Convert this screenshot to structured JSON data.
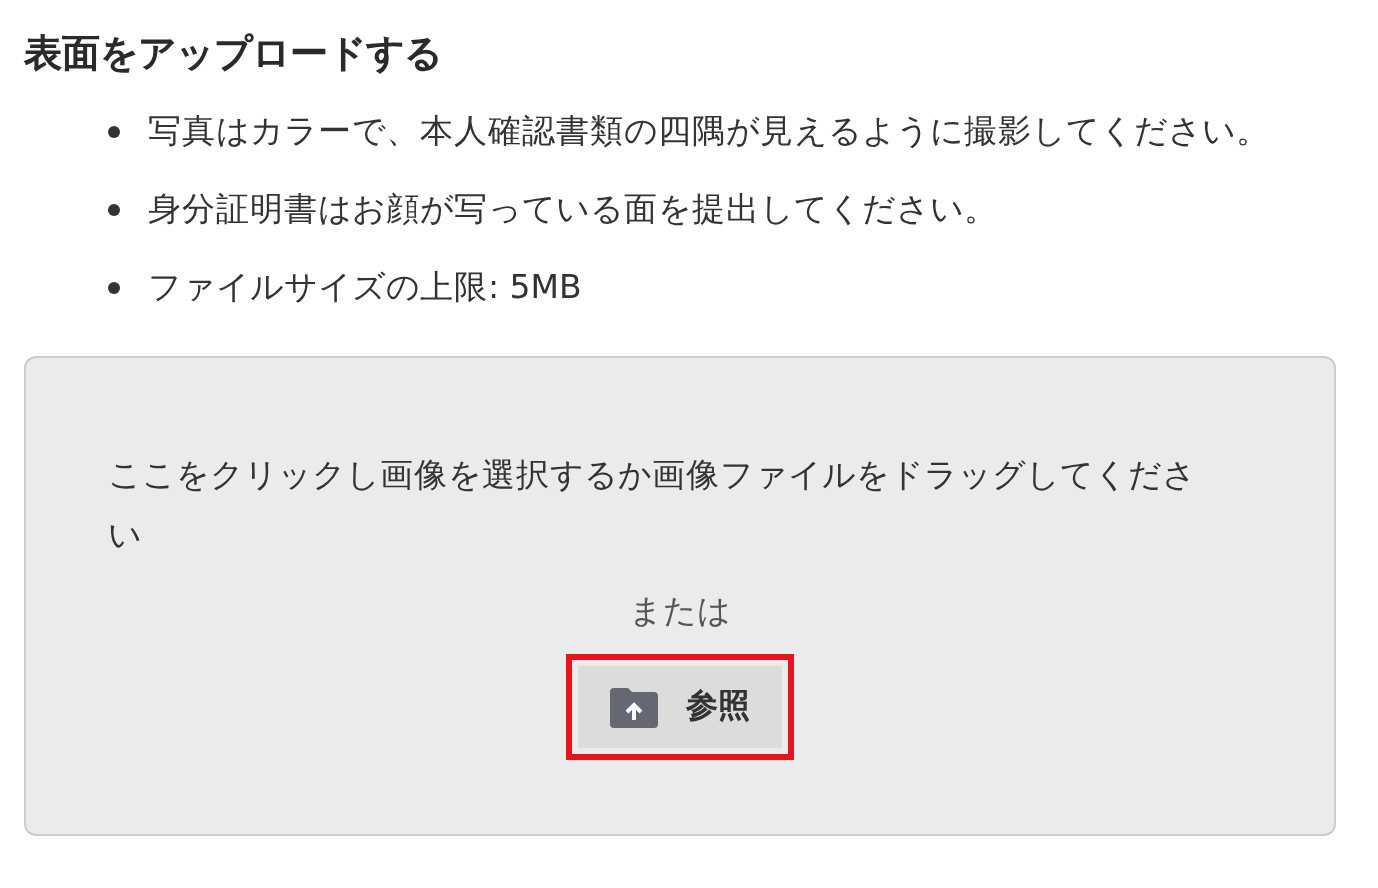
{
  "heading": "表面をアップロードする",
  "instructions": [
    "写真はカラーで、本人確認書類の四隅が見えるように撮影してください。",
    "身分証明書はお顔が写っている面を提出してください。",
    "ファイルサイズの上限: 5MB"
  ],
  "dropzone": {
    "prompt": "ここをクリックし画像を選択するか画像ファイルをドラッグしてください",
    "separator": "または",
    "browse_button": {
      "label": "参照",
      "highlighted": true
    }
  }
}
